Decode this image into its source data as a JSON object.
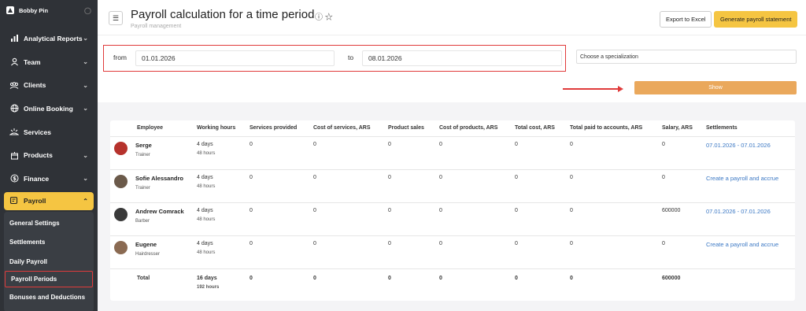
{
  "sidebar": {
    "user_name": "Bobby Pin",
    "items": [
      {
        "label": "Analytical Reports",
        "icon": "chart-bars-icon",
        "has_chevron": true
      },
      {
        "label": "Team",
        "icon": "person-icon",
        "has_chevron": true
      },
      {
        "label": "Clients",
        "icon": "people-icon",
        "has_chevron": true
      },
      {
        "label": "Online Booking",
        "icon": "globe-icon",
        "has_chevron": true
      },
      {
        "label": "Services",
        "icon": "sparkle-icon",
        "has_chevron": false
      },
      {
        "label": "Products",
        "icon": "box-icon",
        "has_chevron": true
      },
      {
        "label": "Finance",
        "icon": "dollar-icon",
        "has_chevron": true
      }
    ],
    "payroll": {
      "label": "Payroll",
      "icon": "payroll-icon"
    },
    "payroll_sub": [
      "General Settings",
      "Settlements",
      "Daily Payroll",
      "Payroll Periods",
      "Bonuses and Deductions"
    ],
    "accent_color": "#f5c542"
  },
  "header": {
    "title": "Payroll calculation for a time period",
    "subtitle": "Payroll management",
    "export_label": "Export to Excel",
    "generate_label": "Generate payroll statement"
  },
  "filters": {
    "from_label": "from",
    "from_value": "01.01.2026",
    "to_label": "to",
    "to_value": "08.01.2026",
    "specialization_placeholder": "Choose a specialization",
    "show_label": "Show"
  },
  "table": {
    "columns": [
      "Employee",
      "Working hours",
      "Services provided",
      "Cost of services, ARS",
      "Product sales",
      "Cost of products, ARS",
      "Total cost, ARS",
      "Total paid to accounts, ARS",
      "Salary, ARS",
      "Settlements"
    ],
    "rows": [
      {
        "name": "Serge",
        "role": "Trainer",
        "days": "4 days",
        "hours": "48 hours",
        "services": "0",
        "cost_services": "0",
        "product_sales": "0",
        "cost_products": "0",
        "total_cost": "0",
        "total_paid": "0",
        "salary": "0",
        "settlement": "07.01.2026 - 07.01.2026",
        "avatar_color": "#b6322c"
      },
      {
        "name": "Sofie Alessandro",
        "role": "Trainer",
        "days": "4 days",
        "hours": "48 hours",
        "services": "0",
        "cost_services": "0",
        "product_sales": "0",
        "cost_products": "0",
        "total_cost": "0",
        "total_paid": "0",
        "salary": "0",
        "settlement": "Create a payroll and accrue",
        "avatar_color": "#6b5a4a"
      },
      {
        "name": "Andrew Comrack",
        "role": "Barber",
        "days": "4 days",
        "hours": "48 hours",
        "services": "0",
        "cost_services": "0",
        "product_sales": "0",
        "cost_products": "0",
        "total_cost": "0",
        "total_paid": "0",
        "salary": "600000",
        "settlement": "07.01.2026 - 07.01.2026",
        "avatar_color": "#3a3a3a"
      },
      {
        "name": "Eugene",
        "role": "Hairdresser",
        "days": "4 days",
        "hours": "48 hours",
        "services": "0",
        "cost_services": "0",
        "product_sales": "0",
        "cost_products": "0",
        "total_cost": "0",
        "total_paid": "0",
        "salary": "0",
        "settlement": "Create a payroll and accrue",
        "avatar_color": "#8a6a52"
      }
    ],
    "total": {
      "label": "Total",
      "days": "16 days",
      "hours": "192 hours",
      "services": "0",
      "cost_services": "0",
      "product_sales": "0",
      "cost_products": "0",
      "total_cost": "0",
      "total_paid": "0",
      "salary": "600000"
    },
    "link_color": "#3b78c4"
  }
}
